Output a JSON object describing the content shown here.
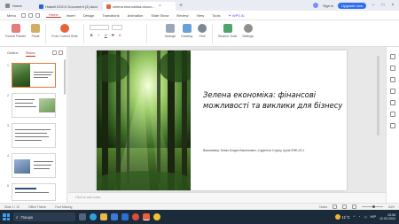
{
  "browser_tabs": {
    "home_label": "Home",
    "tabs": [
      {
        "label": "Новий DOCX Document (3).docx",
        "icon": "docx-icon",
        "color": "#2b5fd9",
        "active": false
      },
      {
        "label": "zelena ekonomika-ekono...",
        "icon": "pptx-icon",
        "color": "#e8623a",
        "active": true
      }
    ],
    "new_tab": "+",
    "sign_in": "Sign in",
    "upgrade": "Upgrade now"
  },
  "menu": {
    "items": [
      "Menu",
      "Home",
      "Insert",
      "Design",
      "Transitions",
      "Animation",
      "Slide Show",
      "Review",
      "View",
      "Tools"
    ],
    "active": "Home",
    "wps_ai": "WPS AI"
  },
  "ribbon": {
    "buttons": [
      {
        "label": "Format Painter",
        "icon": "format-painter-icon"
      },
      {
        "label": "Paste",
        "icon": "paste-icon"
      },
      {
        "label": "From Current Slide",
        "icon": "play-slideshow-icon"
      },
      {
        "label": "Arrange",
        "icon": "arrange-icon"
      },
      {
        "label": "Drawing",
        "icon": "drawing-icon"
      },
      {
        "label": "Find",
        "icon": "find-icon"
      },
      {
        "label": "Student Tools",
        "icon": "student-tools-icon"
      },
      {
        "label": "Settings",
        "icon": "settings-icon"
      }
    ],
    "font_buttons": [
      "B",
      "I",
      "U",
      "S",
      "A"
    ]
  },
  "left_pane": {
    "tabs": [
      "Outline",
      "Slides"
    ],
    "active_tab": "Slides",
    "slide_numbers": [
      "1",
      "2",
      "3",
      "4",
      "5"
    ]
  },
  "slide": {
    "title": "Зелена економіка: фінансові можливості та виклики для бізнесу",
    "subtitle": "Виконавець: Бевко Богдан Васильович, студентка 4 курсу, група ФФБ-23-1"
  },
  "notes_placeholder": "Click to add notes",
  "status": {
    "slide_indicator": "Slide 1 / 10",
    "theme": "Office Theme",
    "font_missing": "Font Missing",
    "notes_label": "Notes",
    "zoom": "64%"
  },
  "taskbar": {
    "search_placeholder": "Пошук",
    "weather_temp": "11°C",
    "time": "15:08",
    "date": "12.03.2024",
    "language": "УКР"
  }
}
